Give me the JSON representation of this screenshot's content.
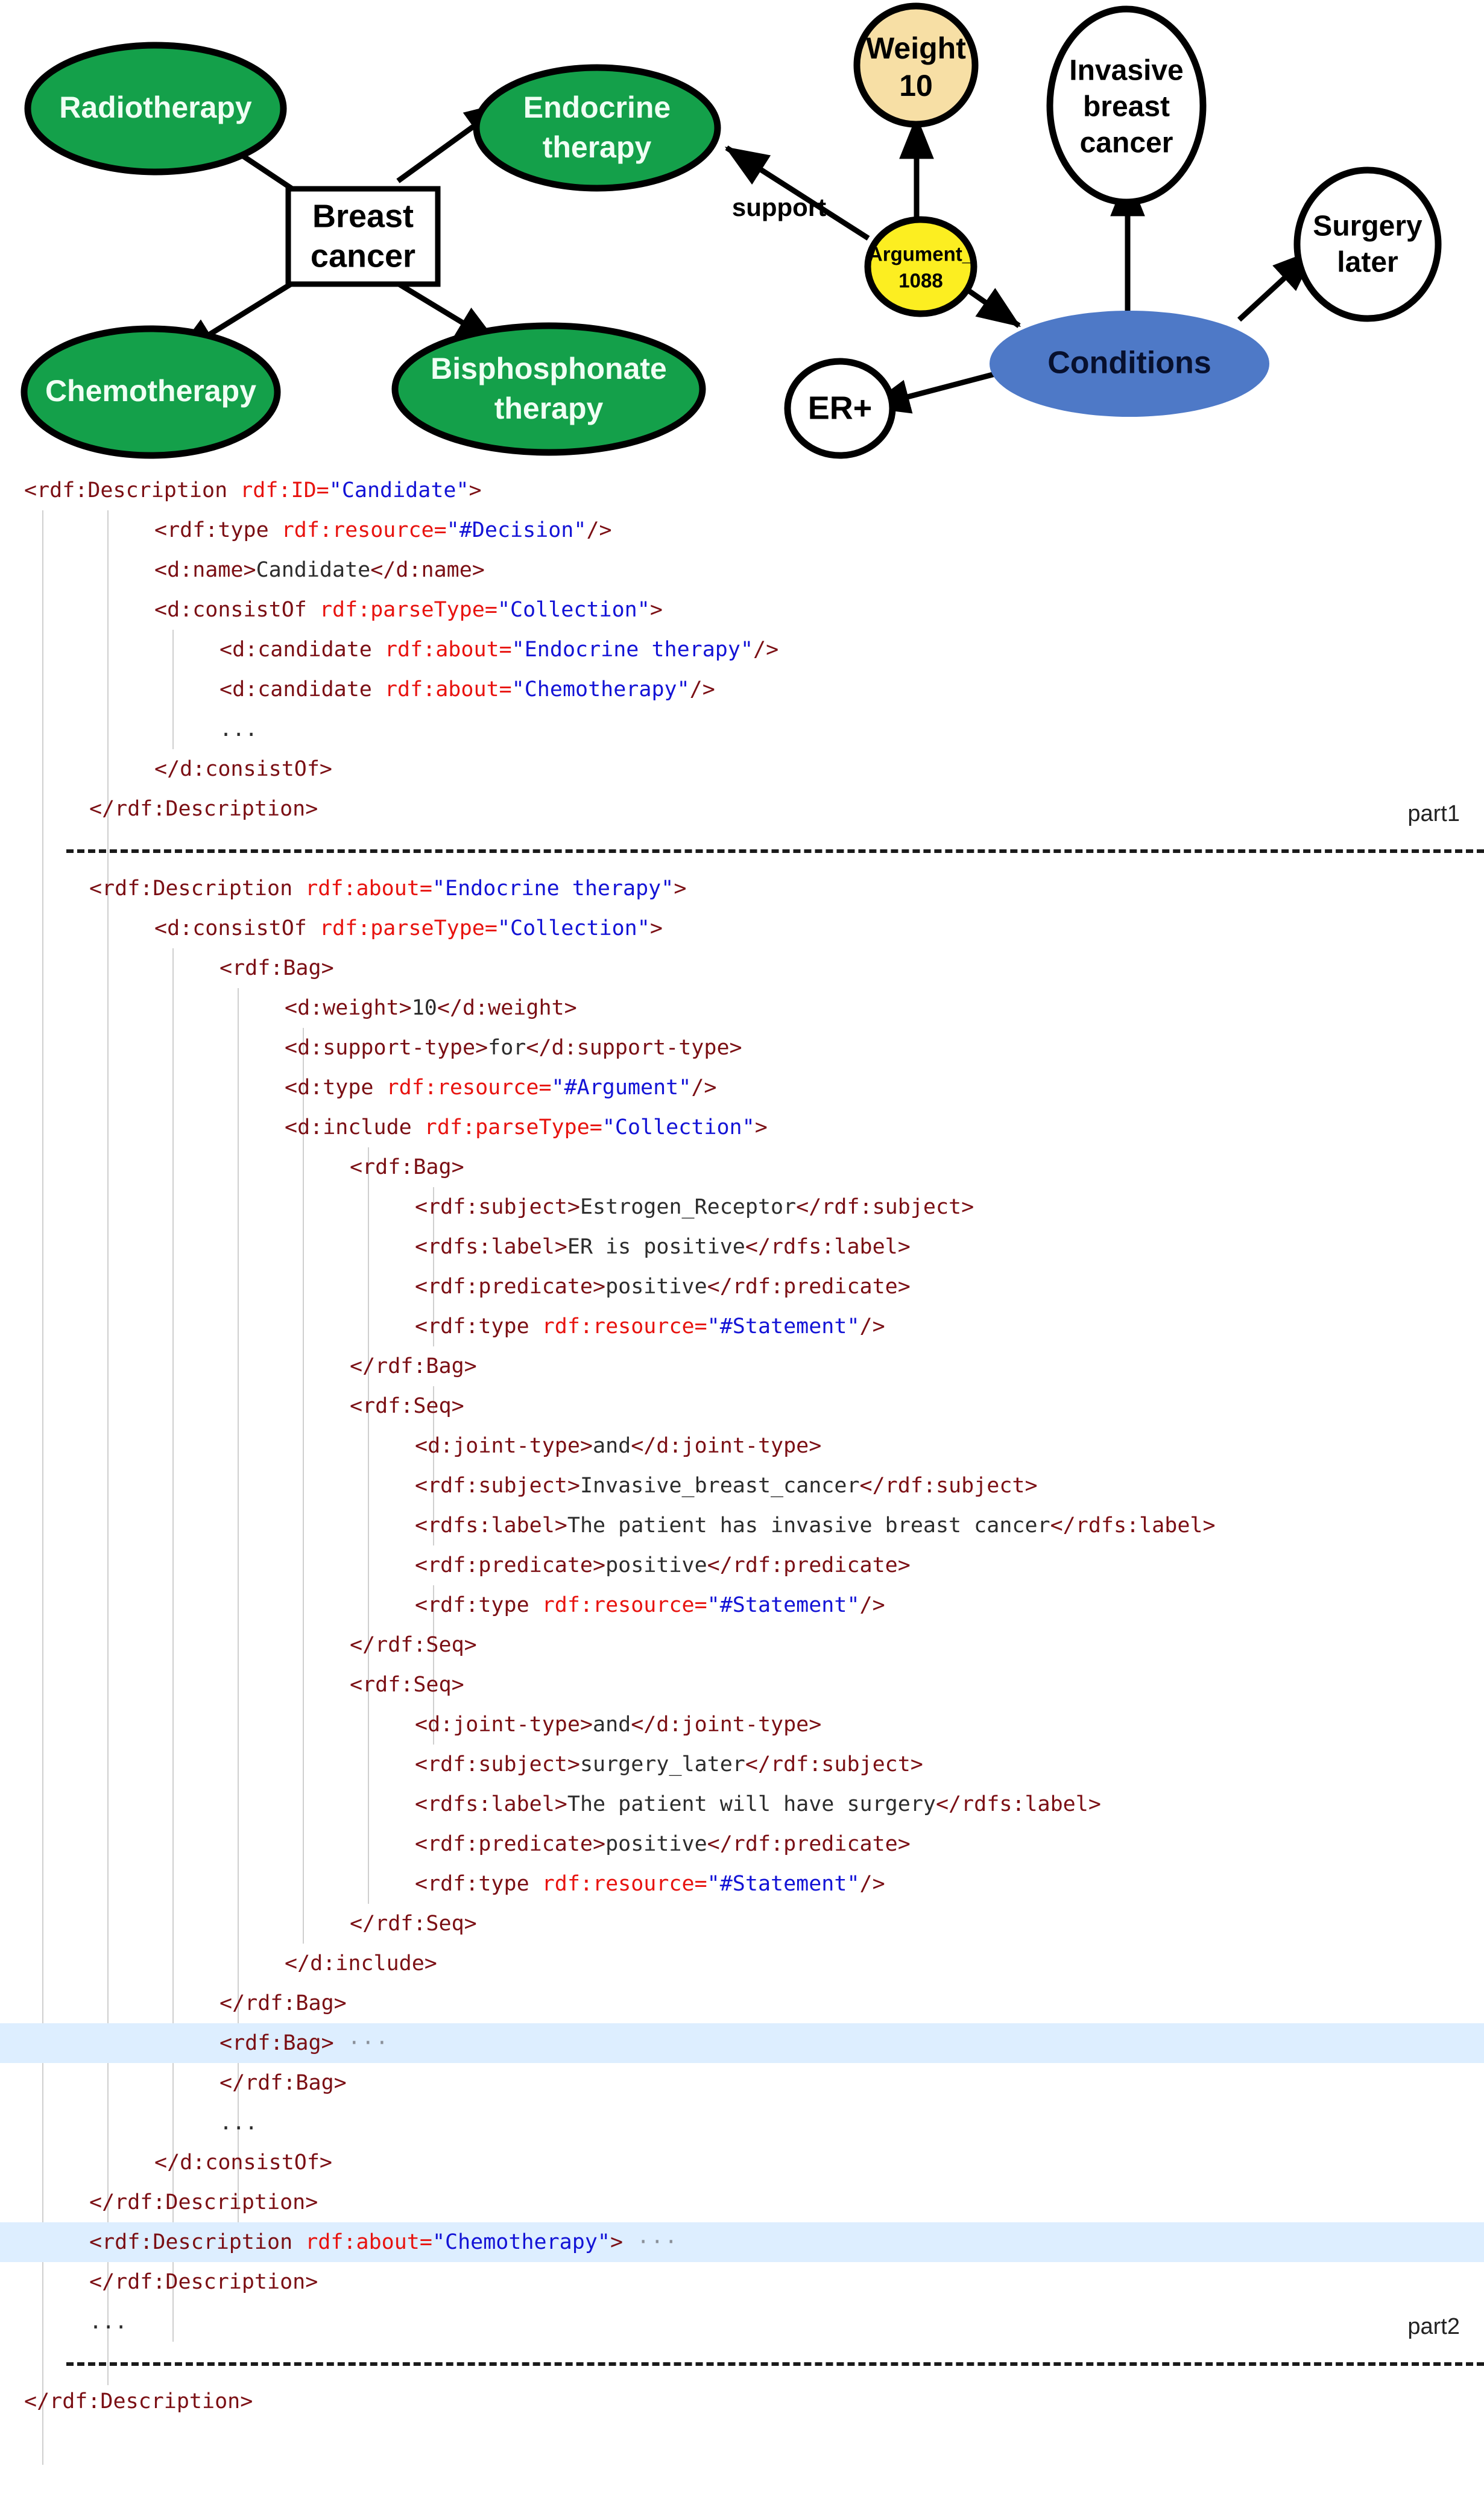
{
  "diagram": {
    "nodes": [
      {
        "id": "radiotherapy",
        "label": "Radiotherapy",
        "shape": "ellipse",
        "fill": "#14a04a",
        "text_color": "#f0fff4"
      },
      {
        "id": "endocrine",
        "label": "Endocrine\ntherapy",
        "shape": "ellipse",
        "fill": "#14a04a",
        "text_color": "#f0fff4"
      },
      {
        "id": "chemotherapy",
        "label": "Chemotherapy",
        "shape": "ellipse",
        "fill": "#14a04a",
        "text_color": "#f0fff4"
      },
      {
        "id": "bisphosphonate",
        "label": "Bisphosphonate\ntherapy",
        "shape": "ellipse",
        "fill": "#14a04a",
        "text_color": "#f0fff4"
      },
      {
        "id": "breast-cancer",
        "label": "Breast\ncancer",
        "shape": "rect",
        "fill": "#ffffff",
        "text_color": "#000000"
      },
      {
        "id": "weight",
        "label": "Weight\n10",
        "shape": "ellipse",
        "fill": "#f7dfa5",
        "text_color": "#000000"
      },
      {
        "id": "argument",
        "label": "Argument_\n1088",
        "shape": "ellipse",
        "fill": "#fcee21",
        "text_color": "#000000"
      },
      {
        "id": "invasive",
        "label": "Invasive\nbreast\ncancer",
        "shape": "ellipse",
        "fill": "#ffffff",
        "text_color": "#000000"
      },
      {
        "id": "surgery",
        "label": "Surgery\nlater",
        "shape": "ellipse",
        "fill": "#ffffff",
        "text_color": "#000000"
      },
      {
        "id": "conditions",
        "label": "Conditions",
        "shape": "ellipse",
        "fill": "#4e79c7",
        "text_color": "#07102e"
      },
      {
        "id": "erplus",
        "label": "ER+",
        "shape": "ellipse",
        "fill": "#ffffff",
        "text_color": "#000000"
      }
    ],
    "edges": [
      {
        "from": "breast-cancer",
        "to": "radiotherapy",
        "label": ""
      },
      {
        "from": "breast-cancer",
        "to": "endocrine",
        "label": ""
      },
      {
        "from": "breast-cancer",
        "to": "chemotherapy",
        "label": ""
      },
      {
        "from": "breast-cancer",
        "to": "bisphosphonate",
        "label": ""
      },
      {
        "from": "argument",
        "to": "endocrine",
        "label": "support"
      },
      {
        "from": "argument",
        "to": "weight",
        "label": ""
      },
      {
        "from": "argument",
        "to": "conditions",
        "label": ""
      },
      {
        "from": "conditions",
        "to": "invasive",
        "label": ""
      },
      {
        "from": "conditions",
        "to": "surgery",
        "label": ""
      },
      {
        "from": "conditions",
        "to": "erplus",
        "label": ""
      }
    ],
    "edge_labels": {
      "support": "support"
    }
  },
  "code": {
    "part1_label": "part1",
    "part2_label": "part2",
    "lines": [
      {
        "indent": 0,
        "hl": false,
        "parts": [
          {
            "t": "tag",
            "s": "<rdf:Description "
          },
          {
            "t": "attr",
            "s": "rdf:ID="
          },
          {
            "t": "val",
            "s": "\"Candidate\""
          },
          {
            "t": "tag",
            "s": ">"
          }
        ]
      },
      {
        "indent": 2,
        "hl": false,
        "parts": [
          {
            "t": "tag",
            "s": "<rdf:type "
          },
          {
            "t": "attr",
            "s": "rdf:resource="
          },
          {
            "t": "val",
            "s": "\"#Decision\""
          },
          {
            "t": "tag",
            "s": "/>"
          }
        ]
      },
      {
        "indent": 2,
        "hl": false,
        "parts": [
          {
            "t": "tag",
            "s": "<d:name>"
          },
          {
            "t": "plain",
            "s": "Candidate"
          },
          {
            "t": "tag",
            "s": "</d:name>"
          }
        ]
      },
      {
        "indent": 2,
        "hl": false,
        "parts": [
          {
            "t": "tag",
            "s": "<d:consistOf "
          },
          {
            "t": "attr",
            "s": "rdf:parseType="
          },
          {
            "t": "val",
            "s": "\"Collection\""
          },
          {
            "t": "tag",
            "s": ">"
          }
        ]
      },
      {
        "indent": 3,
        "hl": false,
        "parts": [
          {
            "t": "tag",
            "s": "<d:candidate "
          },
          {
            "t": "attr",
            "s": "rdf:about="
          },
          {
            "t": "val",
            "s": "\"Endocrine therapy\""
          },
          {
            "t": "tag",
            "s": "/>"
          }
        ]
      },
      {
        "indent": 3,
        "hl": false,
        "parts": [
          {
            "t": "tag",
            "s": "<d:candidate "
          },
          {
            "t": "attr",
            "s": "rdf:about="
          },
          {
            "t": "val",
            "s": "\"Chemotherapy\""
          },
          {
            "t": "tag",
            "s": "/>"
          }
        ]
      },
      {
        "indent": 3,
        "hl": false,
        "parts": [
          {
            "t": "dots",
            "s": "..."
          }
        ]
      },
      {
        "indent": 2,
        "hl": false,
        "parts": [
          {
            "t": "tag",
            "s": "</d:consistOf>"
          }
        ]
      },
      {
        "indent": 1,
        "hl": false,
        "parts": [
          {
            "t": "tag",
            "s": "</rdf:Description>"
          }
        ],
        "right": "part1"
      },
      {
        "indent": 0,
        "hl": false,
        "parts": [],
        "sep": true
      },
      {
        "indent": 1,
        "hl": false,
        "parts": [
          {
            "t": "tag",
            "s": "<rdf:Description "
          },
          {
            "t": "attr",
            "s": "rdf:about="
          },
          {
            "t": "val",
            "s": "\"Endocrine therapy\""
          },
          {
            "t": "tag",
            "s": ">"
          }
        ]
      },
      {
        "indent": 2,
        "hl": false,
        "parts": [
          {
            "t": "tag",
            "s": "<d:consistOf "
          },
          {
            "t": "attr",
            "s": "rdf:parseType="
          },
          {
            "t": "val",
            "s": "\"Collection\""
          },
          {
            "t": "tag",
            "s": ">"
          }
        ]
      },
      {
        "indent": 3,
        "hl": false,
        "parts": [
          {
            "t": "tag",
            "s": "<rdf:Bag>"
          }
        ]
      },
      {
        "indent": 4,
        "hl": false,
        "parts": [
          {
            "t": "tag",
            "s": "<d:weight>"
          },
          {
            "t": "plain",
            "s": "10"
          },
          {
            "t": "tag",
            "s": "</d:weight>"
          }
        ]
      },
      {
        "indent": 4,
        "hl": false,
        "parts": [
          {
            "t": "tag",
            "s": "<d:support-type>"
          },
          {
            "t": "plain",
            "s": "for"
          },
          {
            "t": "tag",
            "s": "</d:support-type>"
          }
        ]
      },
      {
        "indent": 4,
        "hl": false,
        "parts": [
          {
            "t": "tag",
            "s": "<d:type "
          },
          {
            "t": "attr",
            "s": "rdf:resource="
          },
          {
            "t": "val",
            "s": "\"#Argument\""
          },
          {
            "t": "tag",
            "s": "/>"
          }
        ]
      },
      {
        "indent": 4,
        "hl": false,
        "parts": [
          {
            "t": "tag",
            "s": "<d:include "
          },
          {
            "t": "attr",
            "s": "rdf:parseType="
          },
          {
            "t": "val",
            "s": "\"Collection\""
          },
          {
            "t": "tag",
            "s": ">"
          }
        ]
      },
      {
        "indent": 5,
        "hl": false,
        "parts": [
          {
            "t": "tag",
            "s": "<rdf:Bag>"
          }
        ]
      },
      {
        "indent": 6,
        "hl": false,
        "parts": [
          {
            "t": "tag",
            "s": "<rdf:subject>"
          },
          {
            "t": "plain",
            "s": "Estrogen_Receptor"
          },
          {
            "t": "tag",
            "s": "</rdf:subject>"
          }
        ]
      },
      {
        "indent": 6,
        "hl": false,
        "parts": [
          {
            "t": "tag",
            "s": "<rdfs:label>"
          },
          {
            "t": "plain",
            "s": "ER is positive"
          },
          {
            "t": "tag",
            "s": "</rdfs:label>"
          }
        ]
      },
      {
        "indent": 6,
        "hl": false,
        "parts": [
          {
            "t": "tag",
            "s": "<rdf:predicate>"
          },
          {
            "t": "plain",
            "s": "positive"
          },
          {
            "t": "tag",
            "s": "</rdf:predicate>"
          }
        ]
      },
      {
        "indent": 6,
        "hl": false,
        "parts": [
          {
            "t": "tag",
            "s": "<rdf:type "
          },
          {
            "t": "attr",
            "s": "rdf:resource="
          },
          {
            "t": "val",
            "s": "\"#Statement\""
          },
          {
            "t": "tag",
            "s": "/>"
          }
        ]
      },
      {
        "indent": 5,
        "hl": false,
        "parts": [
          {
            "t": "tag",
            "s": "</rdf:Bag>"
          }
        ]
      },
      {
        "indent": 5,
        "hl": false,
        "parts": [
          {
            "t": "tag",
            "s": "<rdf:Seq>"
          }
        ]
      },
      {
        "indent": 6,
        "hl": false,
        "parts": [
          {
            "t": "tag",
            "s": "<d:joint-type>"
          },
          {
            "t": "plain",
            "s": "and"
          },
          {
            "t": "tag",
            "s": "</d:joint-type>"
          }
        ]
      },
      {
        "indent": 6,
        "hl": false,
        "parts": [
          {
            "t": "tag",
            "s": "<rdf:subject>"
          },
          {
            "t": "plain",
            "s": "Invasive_breast_cancer"
          },
          {
            "t": "tag",
            "s": "</rdf:subject>"
          }
        ]
      },
      {
        "indent": 6,
        "hl": false,
        "parts": [
          {
            "t": "tag",
            "s": "<rdfs:label>"
          },
          {
            "t": "plain",
            "s": "The patient has invasive breast cancer"
          },
          {
            "t": "tag",
            "s": "</rdfs:label>"
          }
        ]
      },
      {
        "indent": 6,
        "hl": false,
        "parts": [
          {
            "t": "tag",
            "s": "<rdf:predicate>"
          },
          {
            "t": "plain",
            "s": "positive"
          },
          {
            "t": "tag",
            "s": "</rdf:predicate>"
          }
        ]
      },
      {
        "indent": 6,
        "hl": false,
        "parts": [
          {
            "t": "tag",
            "s": "<rdf:type "
          },
          {
            "t": "attr",
            "s": "rdf:resource="
          },
          {
            "t": "val",
            "s": "\"#Statement\""
          },
          {
            "t": "tag",
            "s": "/>"
          }
        ]
      },
      {
        "indent": 5,
        "hl": false,
        "parts": [
          {
            "t": "tag",
            "s": "</rdf:Seq>"
          }
        ]
      },
      {
        "indent": 5,
        "hl": false,
        "parts": [
          {
            "t": "tag",
            "s": "<rdf:Seq>"
          }
        ]
      },
      {
        "indent": 6,
        "hl": false,
        "parts": [
          {
            "t": "tag",
            "s": "<d:joint-type>"
          },
          {
            "t": "plain",
            "s": "and"
          },
          {
            "t": "tag",
            "s": "</d:joint-type>"
          }
        ]
      },
      {
        "indent": 6,
        "hl": false,
        "parts": [
          {
            "t": "tag",
            "s": "<rdf:subject>"
          },
          {
            "t": "plain",
            "s": "surgery_later"
          },
          {
            "t": "tag",
            "s": "</rdf:subject>"
          }
        ]
      },
      {
        "indent": 6,
        "hl": false,
        "parts": [
          {
            "t": "tag",
            "s": "<rdfs:label>"
          },
          {
            "t": "plain",
            "s": "The patient will have surgery"
          },
          {
            "t": "tag",
            "s": "</rdfs:label>"
          }
        ]
      },
      {
        "indent": 6,
        "hl": false,
        "parts": [
          {
            "t": "tag",
            "s": "<rdf:predicate>"
          },
          {
            "t": "plain",
            "s": "positive"
          },
          {
            "t": "tag",
            "s": "</rdf:predicate>"
          }
        ]
      },
      {
        "indent": 6,
        "hl": false,
        "parts": [
          {
            "t": "tag",
            "s": "<rdf:type "
          },
          {
            "t": "attr",
            "s": "rdf:resource="
          },
          {
            "t": "val",
            "s": "\"#Statement\""
          },
          {
            "t": "tag",
            "s": "/>"
          }
        ]
      },
      {
        "indent": 5,
        "hl": false,
        "parts": [
          {
            "t": "tag",
            "s": "</rdf:Seq>"
          }
        ]
      },
      {
        "indent": 4,
        "hl": false,
        "parts": [
          {
            "t": "tag",
            "s": "</d:include>"
          }
        ]
      },
      {
        "indent": 3,
        "hl": false,
        "parts": [
          {
            "t": "tag",
            "s": "</rdf:Bag>"
          }
        ]
      },
      {
        "indent": 3,
        "hl": true,
        "parts": [
          {
            "t": "tag",
            "s": "<rdf:Bag>"
          },
          {
            "t": "fold",
            "s": " ···"
          }
        ]
      },
      {
        "indent": 3,
        "hl": false,
        "parts": [
          {
            "t": "tag",
            "s": "</rdf:Bag>"
          }
        ]
      },
      {
        "indent": 3,
        "hl": false,
        "parts": [
          {
            "t": "dots",
            "s": "..."
          }
        ]
      },
      {
        "indent": 2,
        "hl": false,
        "parts": [
          {
            "t": "tag",
            "s": "</d:consistOf>"
          }
        ]
      },
      {
        "indent": 1,
        "hl": false,
        "parts": [
          {
            "t": "tag",
            "s": "</rdf:Description>"
          }
        ]
      },
      {
        "indent": 1,
        "hl": true,
        "parts": [
          {
            "t": "tag",
            "s": "<rdf:Description "
          },
          {
            "t": "attr",
            "s": "rdf:about="
          },
          {
            "t": "val",
            "s": "\"Chemotherapy\""
          },
          {
            "t": "tag",
            "s": ">"
          },
          {
            "t": "fold",
            "s": " ···"
          }
        ]
      },
      {
        "indent": 1,
        "hl": false,
        "parts": [
          {
            "t": "tag",
            "s": "</rdf:Description>"
          }
        ]
      },
      {
        "indent": 1,
        "hl": false,
        "parts": [
          {
            "t": "dots",
            "s": "..."
          }
        ],
        "right": "part2"
      },
      {
        "indent": 0,
        "hl": false,
        "parts": [],
        "sep": true
      },
      {
        "indent": 0,
        "hl": false,
        "parts": [
          {
            "t": "tag",
            "s": "</rdf:Description>"
          }
        ]
      }
    ],
    "colors": {
      "tag": "#7b0f14",
      "attribute": "#e8130f",
      "value": "#1313d6",
      "text": "#2c2c2c",
      "highlight_background": "#ddeeff",
      "indent_guide": "#cfcfcf"
    }
  }
}
